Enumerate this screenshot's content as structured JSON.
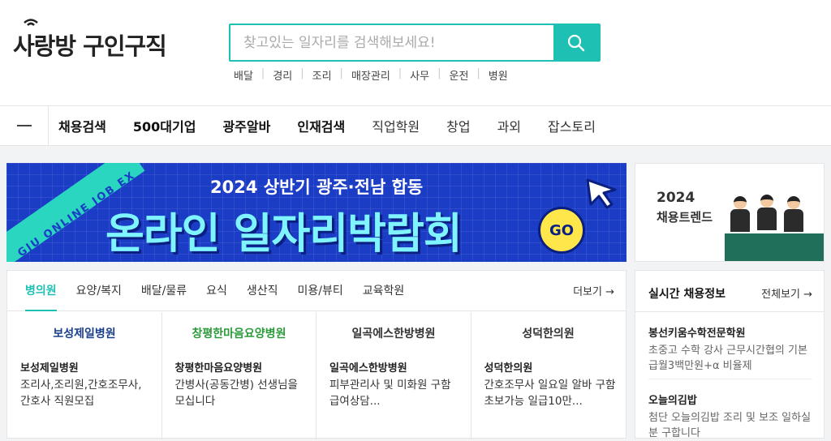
{
  "logo": {
    "text": "사랑방 구인구직"
  },
  "search": {
    "placeholder": "찾고있는 일자리를 검색해보세요!"
  },
  "keywords": [
    "배달",
    "경리",
    "조리",
    "매장관리",
    "사무",
    "운전",
    "병원"
  ],
  "nav": {
    "items": [
      {
        "label": "채용검색",
        "bold": true
      },
      {
        "label": "500대기업",
        "bold": true
      },
      {
        "label": "광주알바",
        "bold": true
      },
      {
        "label": "인재검색",
        "bold": true
      },
      {
        "label": "직업학원",
        "bold": false
      },
      {
        "label": "창업",
        "bold": false
      },
      {
        "label": "과외",
        "bold": false
      },
      {
        "label": "잡스토리",
        "bold": false
      }
    ]
  },
  "banner": {
    "stripe_text": "GJU ONLINE JOB EX",
    "subtitle": "2024 상반기 광주·전남 합동",
    "title": "온라인 일자리박람회",
    "go": "GO"
  },
  "side_banner": {
    "line1": "2024",
    "line2": "채용트렌드"
  },
  "tabs": [
    "병의원",
    "요양/복지",
    "배달/물류",
    "요식",
    "생산직",
    "미용/뷰티",
    "교육학원"
  ],
  "more_label": "더보기 →",
  "cards": [
    {
      "logo": "보성제일병원",
      "name": "보성제일병원",
      "desc": "조리사,조리원,간호조무사, 간호사 직원모집"
    },
    {
      "logo": "창평한마음요양병원",
      "name": "창평한마음요양병원",
      "desc": "간병사(공동간병) 선생님을 모십니다"
    },
    {
      "logo": "일곡에스한방병원",
      "name": "일곡에스한방병원",
      "desc": "피부관리사 및 미화원 구함 급여상담..."
    },
    {
      "logo": "성덕한의원",
      "name": "성덕한의원",
      "desc": "간호조무사 일요일 알바 구함 초보가능 일급10만..."
    }
  ],
  "realtime": {
    "title": "실시간 채용정보",
    "all_label": "전체보기 →",
    "items": [
      {
        "name": "봉선키움수학전문학원",
        "desc": "초중고 수학 강사 근무시간협의 기본급월3백만원+α 비율제"
      },
      {
        "name": "오늘의김밥",
        "desc": "첨단 오늘의김밥 조리 및 보조 일하실분 구합니다"
      }
    ]
  },
  "colors": {
    "accent": "#1ec0b4",
    "banner_bg": "#1b3cc5"
  }
}
